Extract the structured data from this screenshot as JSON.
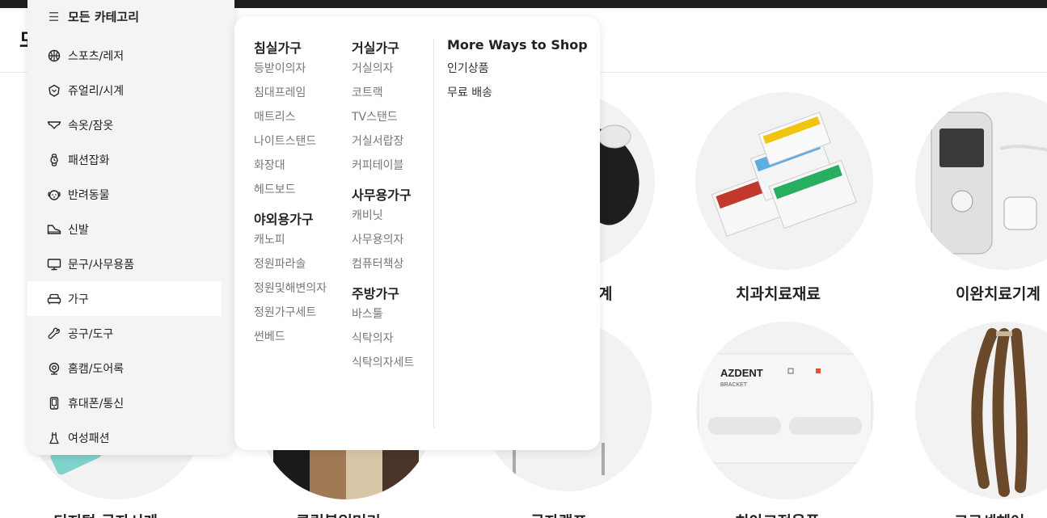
{
  "header": {
    "logo_fragment": "모"
  },
  "category_panel": {
    "title": "모든 카테고리",
    "items": [
      {
        "label": "스포츠/레저",
        "icon": "basketball-icon"
      },
      {
        "label": "쥬얼리/시계",
        "icon": "gem-icon"
      },
      {
        "label": "속옷/잠옷",
        "icon": "underwear-icon"
      },
      {
        "label": "패션잡화",
        "icon": "watch-icon"
      },
      {
        "label": "반려동물",
        "icon": "dog-icon"
      },
      {
        "label": "신발",
        "icon": "shoe-icon"
      },
      {
        "label": "문구/사무용품",
        "icon": "monitor-icon"
      },
      {
        "label": "가구",
        "icon": "sofa-icon",
        "active": true
      },
      {
        "label": "공구/도구",
        "icon": "wrench-icon"
      },
      {
        "label": "홈캠/도어록",
        "icon": "webcam-icon"
      },
      {
        "label": "휴대폰/통신",
        "icon": "phone-icon"
      },
      {
        "label": "여성패션",
        "icon": "dress-icon"
      }
    ]
  },
  "submenu": {
    "col1": [
      {
        "heading": "침실가구",
        "links": [
          "등받이의자",
          "침대프레임",
          "매트리스",
          "나이트스탠드",
          "화장대",
          "헤드보드"
        ]
      },
      {
        "heading": "야외용가구",
        "links": [
          "캐노피",
          "정원파라솔",
          "정원및해변의자",
          "정원가구세트",
          "썬베드"
        ]
      }
    ],
    "col2": [
      {
        "heading": "거실가구",
        "links": [
          "거실의자",
          "코트랙",
          "TV스탠드",
          "거실서랍장",
          "커피테이블"
        ]
      },
      {
        "heading": "사무용가구",
        "links": [
          "캐비닛",
          "사무용의자",
          "컴퓨터책상"
        ]
      },
      {
        "heading": "주방가구",
        "links": [
          "바스툴",
          "식탁의자",
          "식탁의자세트"
        ]
      }
    ],
    "shop": {
      "heading": "More Ways to Shop",
      "links": [
        "인기상품",
        "무료 배송"
      ]
    }
  },
  "background_categories": {
    "row1": [
      "계",
      "치과치료재료",
      "이완치료기계"
    ],
    "row2": [
      "디지털 글자시계",
      "클립붙임머리",
      "글자램프",
      "치아교정용품",
      "크로셰헤어"
    ]
  },
  "colors": {
    "panel_bg": "#f4f4f4",
    "active_bg": "#ffffff",
    "link_gray": "#777777",
    "topbar": "#1f1f1f"
  }
}
